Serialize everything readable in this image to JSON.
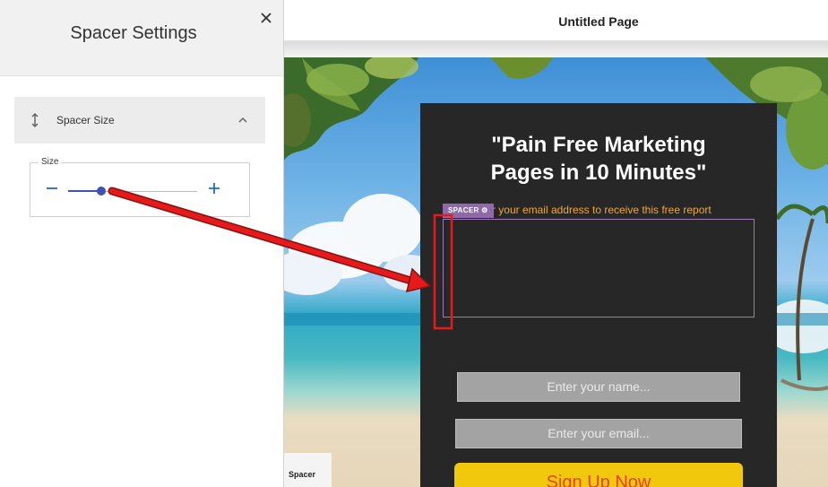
{
  "panel": {
    "title": "Spacer Settings",
    "section_label": "Spacer Size",
    "size_label": "Size",
    "slider_fraction": 0.26
  },
  "topbar": {
    "page_title": "Untitled Page"
  },
  "canvas": {
    "headline_line1": "\"Pain Free Marketing",
    "headline_line2": "Pages in 10 Minutes\"",
    "subtext": "er your email address to receive this free report",
    "spacer_badge": "SPACER",
    "name_placeholder": "Enter your name...",
    "email_placeholder": "Enter your email...",
    "signup_label": "Sign Up Now",
    "spacer_tag": "Spacer"
  },
  "colors": {
    "accent": "#3f51b5",
    "annotation": "#e51b1b",
    "signup": "#f2c80d",
    "badge": "#8e6aa8",
    "subtext": "#f0a830"
  },
  "icons": [
    "close-icon",
    "vertical-resize-icon",
    "chevron-up-icon",
    "minus-icon",
    "plus-icon",
    "gear-icon"
  ]
}
